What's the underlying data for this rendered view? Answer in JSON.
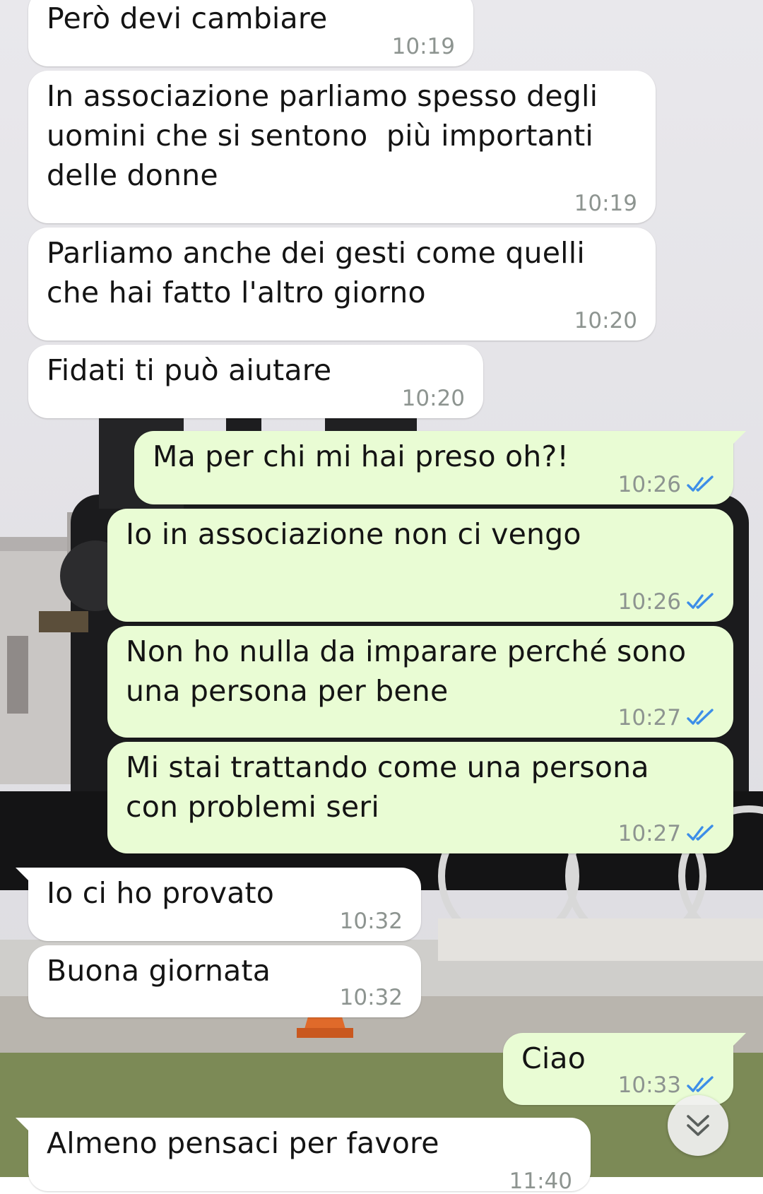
{
  "colors": {
    "incoming_bubble": "#ffffff",
    "outgoing_bubble": "#e9fcd4",
    "timestamp": "#8d9490",
    "read_ticks": "#3d8ee8"
  },
  "messages": [
    {
      "direction": "incoming",
      "text": "Però devi cambiare",
      "time": "10:19"
    },
    {
      "direction": "incoming",
      "text": "In associazione parliamo spesso degli\nuomini che si sentono  più importanti\ndelle donne",
      "time": "10:19"
    },
    {
      "direction": "incoming",
      "text": "Parliamo anche dei gesti come quelli\nche hai fatto l'altro giorno",
      "time": "10:20"
    },
    {
      "direction": "incoming",
      "text": "Fidati ti può aiutare",
      "time": "10:20"
    },
    {
      "direction": "outgoing",
      "text": "Ma per chi mi hai preso oh?!",
      "time": "10:26",
      "status": "read"
    },
    {
      "direction": "outgoing",
      "text": "Io in associazione non ci vengo",
      "time": "10:26",
      "status": "read"
    },
    {
      "direction": "outgoing",
      "text": "Non ho nulla da imparare perché sono\nuna persona per bene",
      "time": "10:27",
      "status": "read"
    },
    {
      "direction": "outgoing",
      "text": "Mi stai trattando come una persona\ncon problemi seri",
      "time": "10:27",
      "status": "read"
    },
    {
      "direction": "incoming",
      "text": "Io ci ho provato",
      "time": "10:32"
    },
    {
      "direction": "incoming",
      "text": "Buona giornata",
      "time": "10:32"
    },
    {
      "direction": "outgoing",
      "text": "Ciao",
      "time": "10:33",
      "status": "read"
    },
    {
      "direction": "incoming",
      "text": "Almeno pensaci per favore",
      "time": "11:40"
    }
  ],
  "scroll_button": {
    "icon": "double-chevron-down-icon"
  }
}
